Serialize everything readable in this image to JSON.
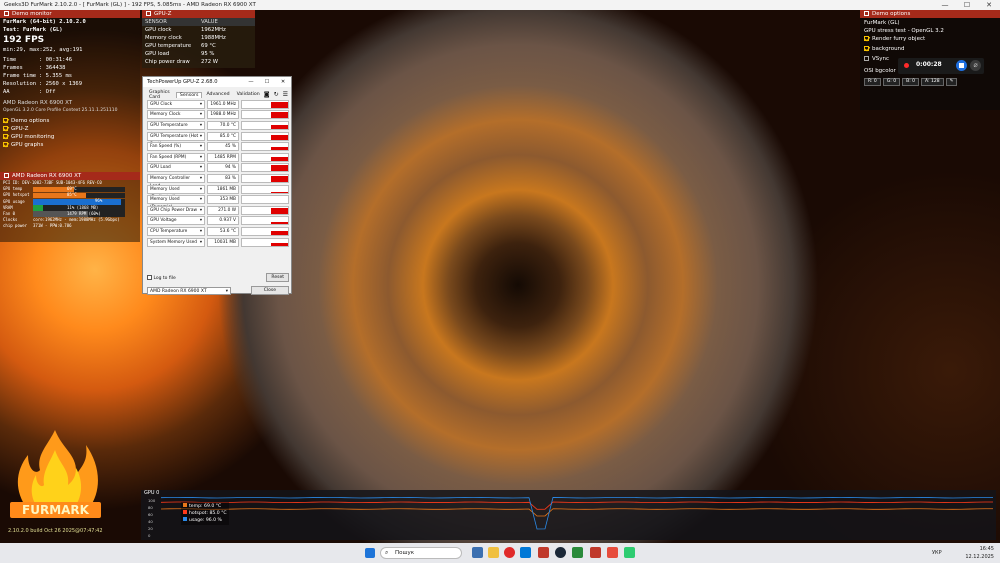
{
  "window": {
    "title": "Geeks3D FurMark 2.10.2.0 - [ FurMark (GL) ] - 192 FPS, 5.085ms - AMD Radeon RX 6900 XT",
    "minimize": "—",
    "maximize": "☐",
    "close": "✕"
  },
  "monitor": {
    "header": "Demo monitor",
    "app": "FurMark (64-bit) 2.10.2.0",
    "test": "Test: FurMark (GL)",
    "fps": "192 FPS",
    "fps_stats": "min:29, max:252, avg:191",
    "stats": [
      {
        "k": "Time",
        "v": ": 00:31:46"
      },
      {
        "k": "Frames",
        "v": ": 364438"
      },
      {
        "k": "Frame time",
        "v": ": 5.355 ms"
      },
      {
        "k": "Resolution",
        "v": ": 2560 x 1369"
      },
      {
        "k": "AA",
        "v": ": Off"
      }
    ],
    "gpu_name": "AMD Radeon RX 6900 XT",
    "opengl": "OpenGL 3.2.0 Core Profile Context 25.11.1.251110",
    "options": [
      {
        "label": "Demo options",
        "on": true
      },
      {
        "label": "GPU-Z",
        "on": true
      },
      {
        "label": "GPU monitoring",
        "on": true
      },
      {
        "label": "GPU graphs",
        "on": true
      }
    ]
  },
  "gpu_panel": {
    "header": "AMD Radeon RX 6900 XT",
    "pci": "PCI ID: DEV-1002-73BF SUB-1043-4F6 REV-C0",
    "rows": [
      {
        "k": "GPU temp",
        "v": "69°C",
        "pct": 0.45,
        "color": "#e8761a"
      },
      {
        "k": "GPU hotspot",
        "v": "85°C",
        "pct": 0.58,
        "color": "#e8761a"
      },
      {
        "k": "GPU usage",
        "v": "96%",
        "pct": 0.96,
        "color": "#1a6fd0"
      },
      {
        "k": "VRAM",
        "v": "11% (1868 MB)",
        "pct": 0.11,
        "color": "#20a040"
      },
      {
        "k": "Fan 0",
        "v": "1479 RPM (60%)",
        "pct": 0.6,
        "color": "#555"
      }
    ],
    "clocks": "core:1962MHz - mem:1988MHz (5.9Gbps)",
    "chip_power": "371W - PPW:0.786",
    "clocks_k": "Clocks",
    "power_k": "chip power"
  },
  "gpuz_panel": {
    "header": "GPU-Z",
    "col_sensor": "SENSOR",
    "col_value": "VALUE",
    "rows": [
      {
        "k": "GPU clock",
        "v": "1962MHz"
      },
      {
        "k": "Memory clock",
        "v": "1988MHz"
      },
      {
        "k": "GPU temperature",
        "v": "69 °C"
      },
      {
        "k": "GPU load",
        "v": "95 %"
      },
      {
        "k": "Chip power draw",
        "v": "272 W"
      }
    ]
  },
  "techpowerup": {
    "title": "TechPowerUp GPU-Z 2.68.0",
    "tabs": [
      "Graphics Card",
      "Sensors",
      "Advanced",
      "Validation"
    ],
    "sensors": [
      {
        "n": "GPU Clock",
        "v": "1961.0 MHz",
        "g": 0.85
      },
      {
        "n": "Memory Clock",
        "v": "1988.0 MHz",
        "g": 0.9
      },
      {
        "n": "GPU Temperature",
        "v": "70.0 °C",
        "g": 0.6
      },
      {
        "n": "GPU Temperature (Hot Spot)",
        "v": "85.0 °C",
        "g": 0.7
      },
      {
        "n": "Fan Speed (%)",
        "v": "45 %",
        "g": 0.45
      },
      {
        "n": "Fan Speed (RPM)",
        "v": "1485 RPM",
        "g": 0.5
      },
      {
        "n": "GPU Load",
        "v": "94 %",
        "g": 0.94
      },
      {
        "n": "Memory Controller Load",
        "v": "83 %",
        "g": 0.83
      },
      {
        "n": "Memory Used (Dedicated)",
        "v": "1861 MB",
        "g": 0.12
      },
      {
        "n": "Memory Used (Dynamic)",
        "v": "353 MB",
        "g": 0.05
      },
      {
        "n": "GPU Chip Power Draw",
        "v": "271.0 W",
        "g": 0.8
      },
      {
        "n": "GPU Voltage",
        "v": "0.937 V",
        "g": 0.4
      },
      {
        "n": "CPU Temperature",
        "v": "53.6 °C",
        "g": 0.5
      },
      {
        "n": "System Memory Used",
        "v": "10031 MB",
        "g": 0.35
      }
    ],
    "log_label": "Log to file",
    "reset": "Reset",
    "device": "AMD Radeon RX 6900 XT",
    "close": "Close"
  },
  "demo_options": {
    "header": "Demo options",
    "name": "FurMark (GL)",
    "desc": "GPU stress test - OpenGL 3.2",
    "checks": [
      {
        "label": "Render furry object",
        "on": true
      },
      {
        "label": "background",
        "on": true
      },
      {
        "label": "VSync",
        "on": false
      }
    ],
    "timer": "0:00:28",
    "bg_label": "OSI bgcolor",
    "bg_values": [
      "R: 0",
      "G: 0",
      "B: 0",
      "A: 128"
    ]
  },
  "graph": {
    "label": "GPU 0",
    "yticks": [
      "100",
      "80",
      "60",
      "40",
      "20",
      "0"
    ],
    "legend": [
      "temp: 69.0 °C",
      "hotspot: 85.0 °C",
      "usage: 96.0 %"
    ],
    "temp": 69,
    "hotspot": 85,
    "usage": 96
  },
  "build": "2.10.2.0 build Oct 26 2025@07:47:42",
  "taskbar": {
    "search": "Пошук",
    "lang": "УКР",
    "time": "16:45",
    "date": "12.12.2025"
  }
}
